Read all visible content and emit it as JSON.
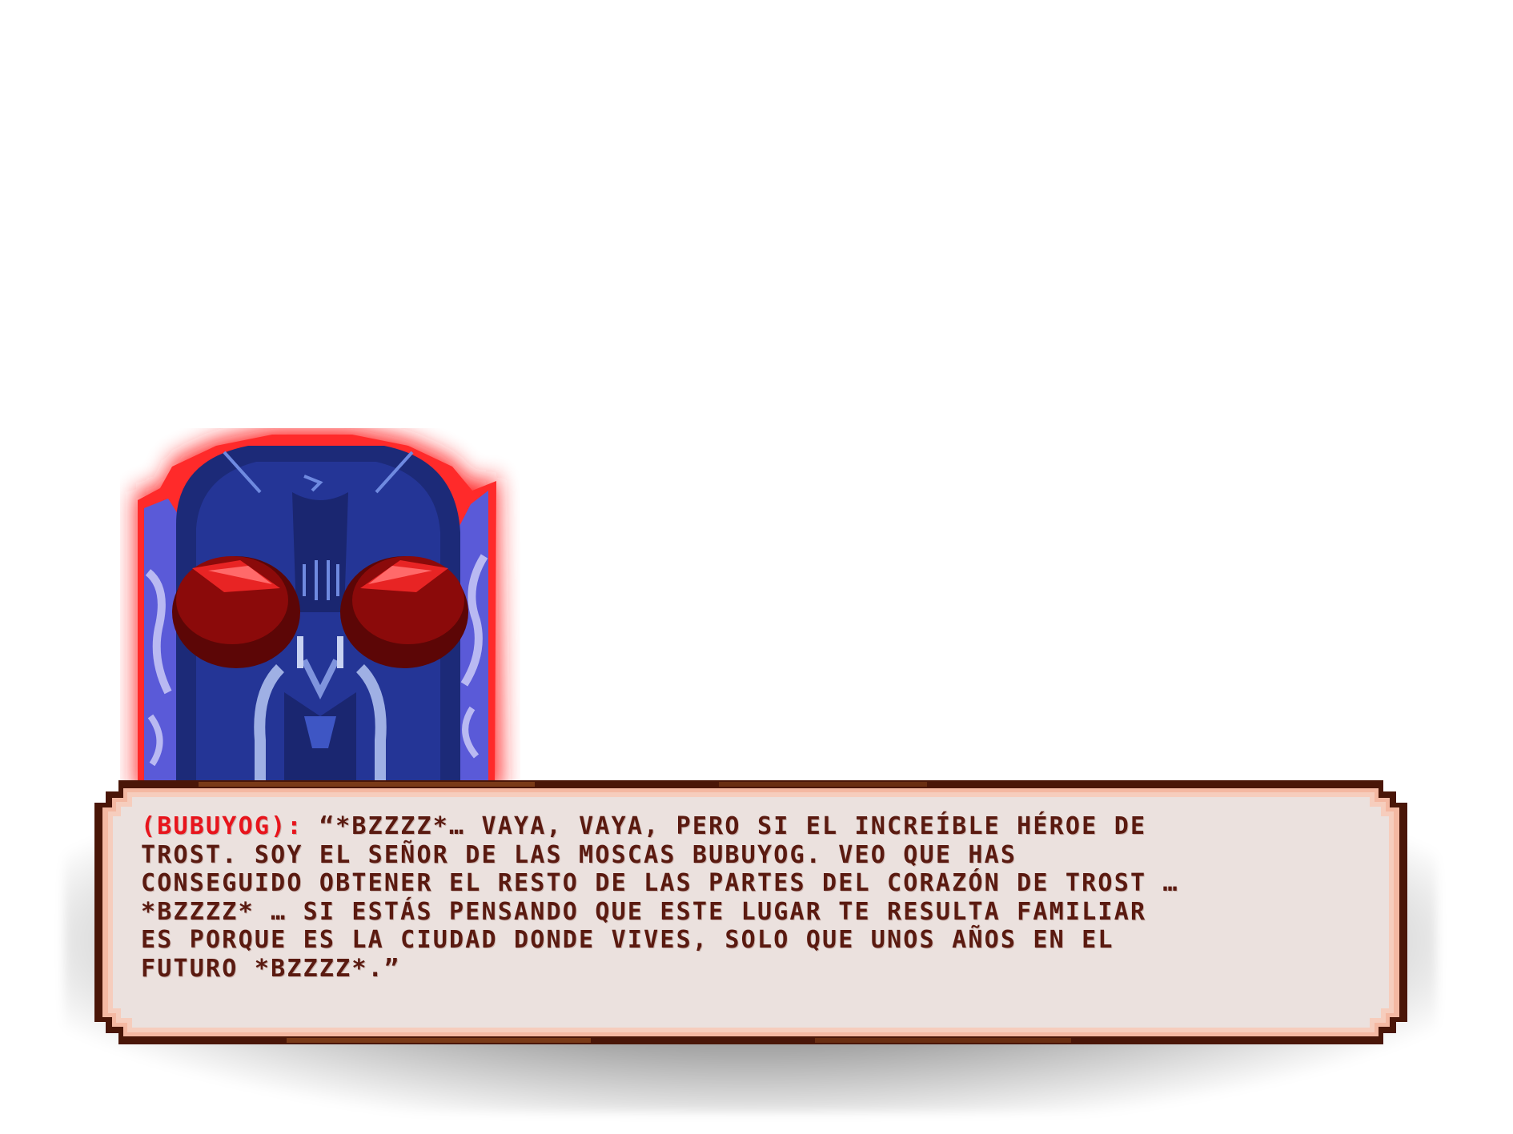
{
  "speaker": {
    "name": "(BUBUYOG):",
    "color": "#e8141c"
  },
  "dialog": {
    "lines": [
      "“*BZZZZ*… VAYA, VAYA, PERO SI EL INCREÍBLE HÉROE DE",
      "TROST. SOY EL SEÑOR DE LAS MOSCAS BUBUYOG. VEO QUE HAS",
      "CONSEGUIDO OBTENER EL RESTO DE LAS PARTES DEL CORAZÓN DE TROST …",
      "*BZZZZ* … SI ESTÁS PENSANDO QUE ESTE LUGAR TE RESULTA FAMILIAR",
      "ES PORQUE ES LA CIUDAD DONDE VIVES, SOLO QUE UNOS AÑOS EN EL",
      "FUTURO *BZZZZ*.”"
    ],
    "text_color": "#5a1a10",
    "panel_color": "#ebe1de",
    "border_color": "#4a1608"
  },
  "portrait": {
    "icon": "fly-lord-bubuyog-portrait",
    "glow_color": "#ff1a1a",
    "head_color": "#1c2a78",
    "eye_color": "#8b0a0a"
  }
}
